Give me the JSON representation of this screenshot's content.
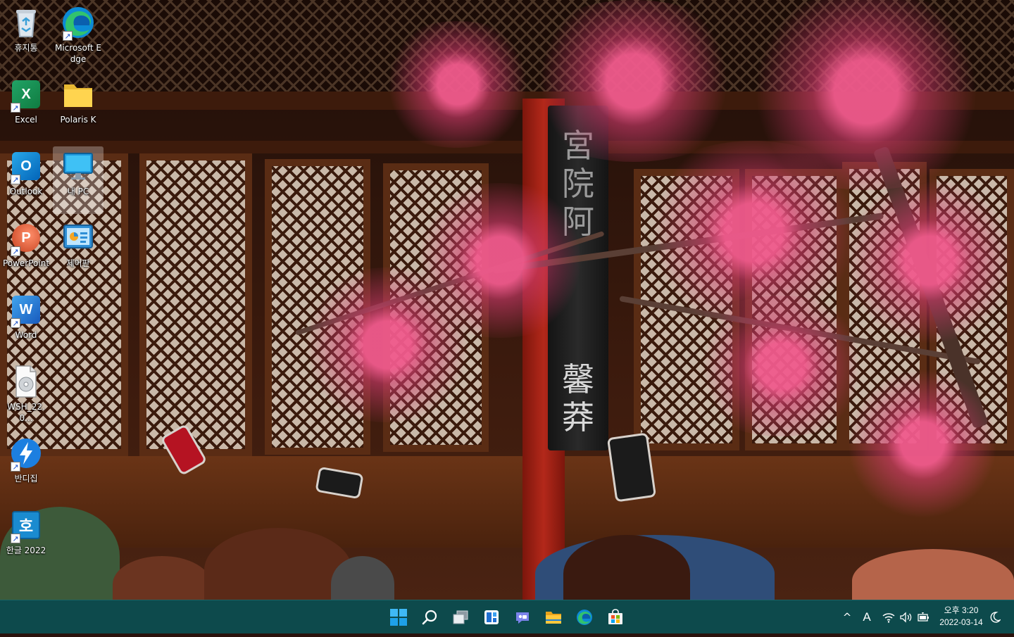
{
  "desktop": {
    "icons": [
      {
        "id": "recycle",
        "label": "휴지통"
      },
      {
        "id": "edge",
        "label": "Microsoft Edge"
      },
      {
        "id": "excel",
        "label": "Excel"
      },
      {
        "id": "polaris",
        "label": "Polaris K"
      },
      {
        "id": "outlook",
        "label": "Outlook"
      },
      {
        "id": "mypc",
        "label": "내 PC"
      },
      {
        "id": "powerpoint",
        "label": "PowerPoint"
      },
      {
        "id": "control",
        "label": "제어판"
      },
      {
        "id": "word",
        "label": "Word"
      },
      {
        "id": "wsh",
        "label": "WSH_22.0..."
      },
      {
        "id": "bandizip",
        "label": "반디집"
      },
      {
        "id": "hangul",
        "label": "한글 2022"
      }
    ],
    "selected_icon": "mypc",
    "wallpaper": {
      "plaque_top": "宮院阿",
      "plaque_bottom": "馨莽"
    },
    "icon_letters": {
      "excel": "X",
      "outlook": "O",
      "powerpoint": "P",
      "word": "W",
      "hangul": "호",
      "shortcut": "↗"
    }
  },
  "taskbar": {
    "apps": [
      "start",
      "search",
      "task-view",
      "widgets",
      "chat",
      "file-explorer",
      "edge",
      "store"
    ],
    "tray": {
      "chevron": "^",
      "ime": "A"
    },
    "clock": {
      "time": "오후 3:20",
      "date": "2022-03-14"
    },
    "colors": {
      "bar": "#0d4a4c",
      "accent": "#0078d4"
    }
  }
}
